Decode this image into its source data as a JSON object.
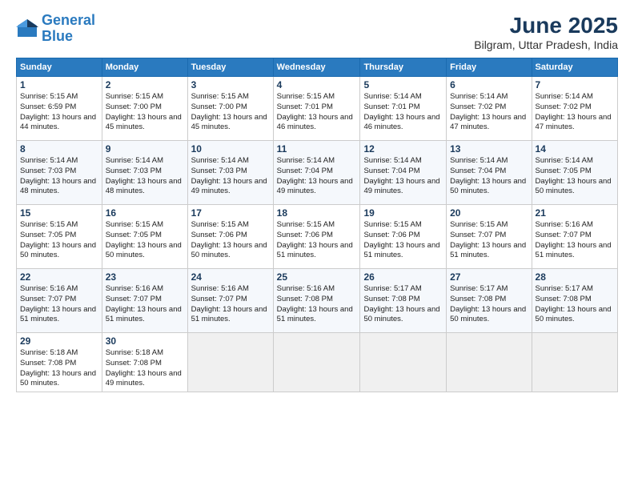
{
  "header": {
    "logo_line1": "General",
    "logo_line2": "Blue",
    "title": "June 2025",
    "location": "Bilgram, Uttar Pradesh, India"
  },
  "weekdays": [
    "Sunday",
    "Monday",
    "Tuesday",
    "Wednesday",
    "Thursday",
    "Friday",
    "Saturday"
  ],
  "weeks": [
    [
      {
        "day": "1",
        "sunrise": "5:15 AM",
        "sunset": "6:59 PM",
        "daylight": "13 hours and 44 minutes."
      },
      {
        "day": "2",
        "sunrise": "5:15 AM",
        "sunset": "7:00 PM",
        "daylight": "13 hours and 45 minutes."
      },
      {
        "day": "3",
        "sunrise": "5:15 AM",
        "sunset": "7:00 PM",
        "daylight": "13 hours and 45 minutes."
      },
      {
        "day": "4",
        "sunrise": "5:15 AM",
        "sunset": "7:01 PM",
        "daylight": "13 hours and 46 minutes."
      },
      {
        "day": "5",
        "sunrise": "5:14 AM",
        "sunset": "7:01 PM",
        "daylight": "13 hours and 46 minutes."
      },
      {
        "day": "6",
        "sunrise": "5:14 AM",
        "sunset": "7:02 PM",
        "daylight": "13 hours and 47 minutes."
      },
      {
        "day": "7",
        "sunrise": "5:14 AM",
        "sunset": "7:02 PM",
        "daylight": "13 hours and 47 minutes."
      }
    ],
    [
      {
        "day": "8",
        "sunrise": "5:14 AM",
        "sunset": "7:03 PM",
        "daylight": "13 hours and 48 minutes."
      },
      {
        "day": "9",
        "sunrise": "5:14 AM",
        "sunset": "7:03 PM",
        "daylight": "13 hours and 48 minutes."
      },
      {
        "day": "10",
        "sunrise": "5:14 AM",
        "sunset": "7:03 PM",
        "daylight": "13 hours and 49 minutes."
      },
      {
        "day": "11",
        "sunrise": "5:14 AM",
        "sunset": "7:04 PM",
        "daylight": "13 hours and 49 minutes."
      },
      {
        "day": "12",
        "sunrise": "5:14 AM",
        "sunset": "7:04 PM",
        "daylight": "13 hours and 49 minutes."
      },
      {
        "day": "13",
        "sunrise": "5:14 AM",
        "sunset": "7:04 PM",
        "daylight": "13 hours and 50 minutes."
      },
      {
        "day": "14",
        "sunrise": "5:14 AM",
        "sunset": "7:05 PM",
        "daylight": "13 hours and 50 minutes."
      }
    ],
    [
      {
        "day": "15",
        "sunrise": "5:15 AM",
        "sunset": "7:05 PM",
        "daylight": "13 hours and 50 minutes."
      },
      {
        "day": "16",
        "sunrise": "5:15 AM",
        "sunset": "7:05 PM",
        "daylight": "13 hours and 50 minutes."
      },
      {
        "day": "17",
        "sunrise": "5:15 AM",
        "sunset": "7:06 PM",
        "daylight": "13 hours and 50 minutes."
      },
      {
        "day": "18",
        "sunrise": "5:15 AM",
        "sunset": "7:06 PM",
        "daylight": "13 hours and 51 minutes."
      },
      {
        "day": "19",
        "sunrise": "5:15 AM",
        "sunset": "7:06 PM",
        "daylight": "13 hours and 51 minutes."
      },
      {
        "day": "20",
        "sunrise": "5:15 AM",
        "sunset": "7:07 PM",
        "daylight": "13 hours and 51 minutes."
      },
      {
        "day": "21",
        "sunrise": "5:16 AM",
        "sunset": "7:07 PM",
        "daylight": "13 hours and 51 minutes."
      }
    ],
    [
      {
        "day": "22",
        "sunrise": "5:16 AM",
        "sunset": "7:07 PM",
        "daylight": "13 hours and 51 minutes."
      },
      {
        "day": "23",
        "sunrise": "5:16 AM",
        "sunset": "7:07 PM",
        "daylight": "13 hours and 51 minutes."
      },
      {
        "day": "24",
        "sunrise": "5:16 AM",
        "sunset": "7:07 PM",
        "daylight": "13 hours and 51 minutes."
      },
      {
        "day": "25",
        "sunrise": "5:16 AM",
        "sunset": "7:08 PM",
        "daylight": "13 hours and 51 minutes."
      },
      {
        "day": "26",
        "sunrise": "5:17 AM",
        "sunset": "7:08 PM",
        "daylight": "13 hours and 50 minutes."
      },
      {
        "day": "27",
        "sunrise": "5:17 AM",
        "sunset": "7:08 PM",
        "daylight": "13 hours and 50 minutes."
      },
      {
        "day": "28",
        "sunrise": "5:17 AM",
        "sunset": "7:08 PM",
        "daylight": "13 hours and 50 minutes."
      }
    ],
    [
      {
        "day": "29",
        "sunrise": "5:18 AM",
        "sunset": "7:08 PM",
        "daylight": "13 hours and 50 minutes."
      },
      {
        "day": "30",
        "sunrise": "5:18 AM",
        "sunset": "7:08 PM",
        "daylight": "13 hours and 49 minutes."
      },
      null,
      null,
      null,
      null,
      null
    ]
  ]
}
